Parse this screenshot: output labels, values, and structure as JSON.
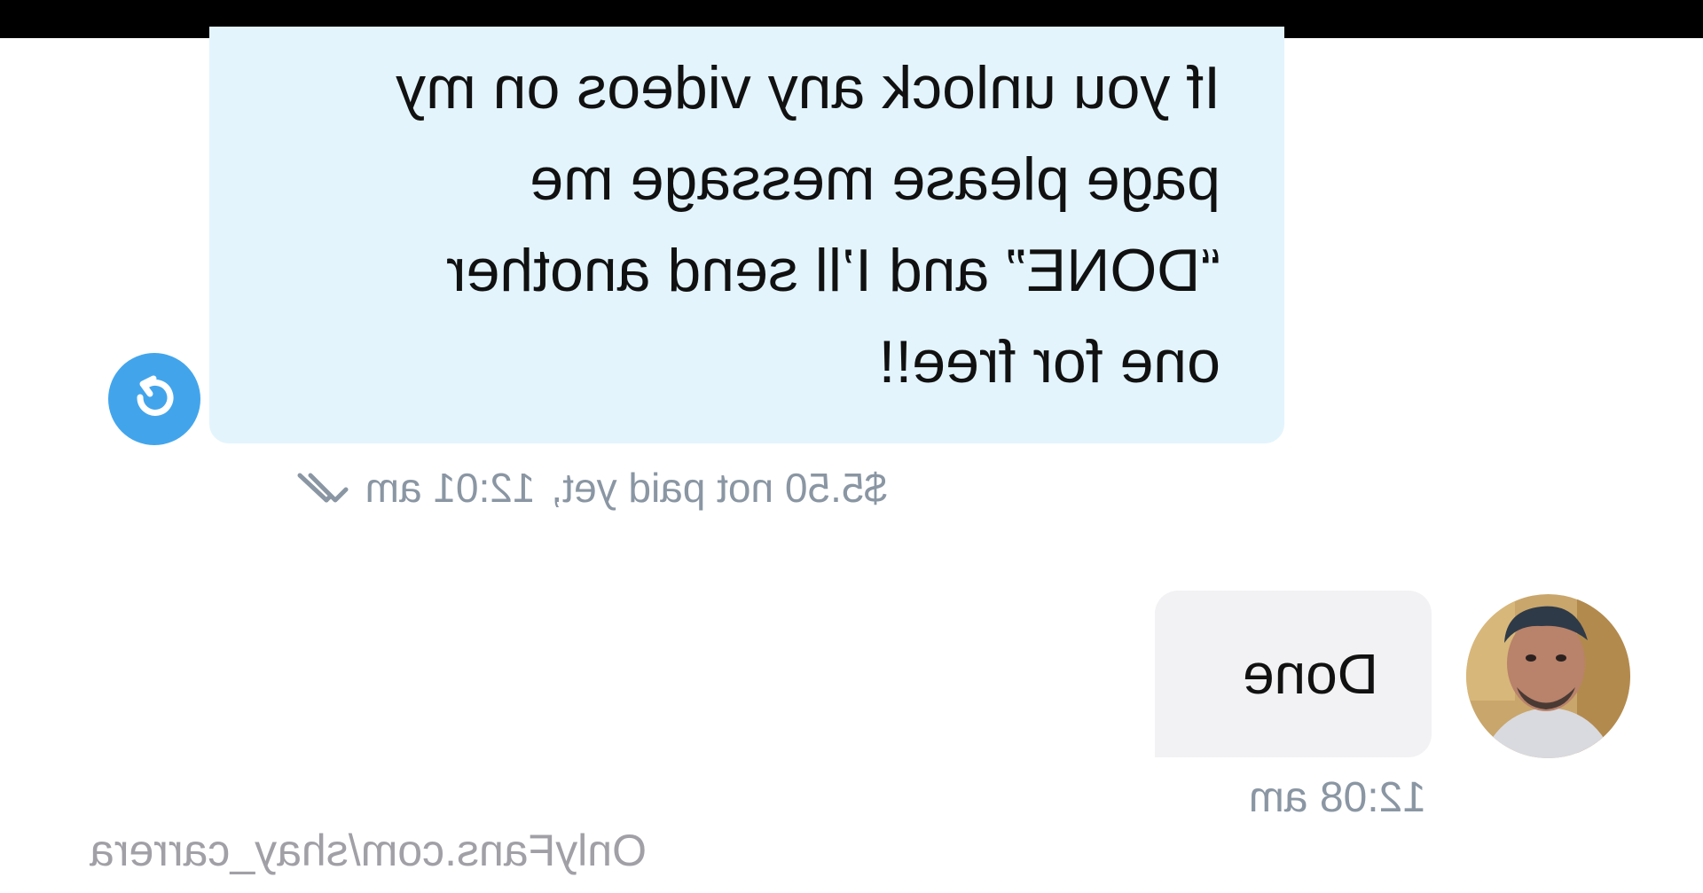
{
  "top_bar": {
    "color": "#000000"
  },
  "messages": [
    {
      "direction": "incoming",
      "text": "If you unlock any videos on my\npage please message me\n“DONE” and I’ll send another\none for free!!",
      "price_label": "$5.50 not paid yet,",
      "time": "12:01 am",
      "bubble_color": "#e3f4fd",
      "badge_icon": "repeat-icon",
      "badge_color": "#42a5ec",
      "status_icon": "double-check-icon"
    },
    {
      "direction": "outgoing",
      "text": "Done",
      "time": "12:08 am",
      "bubble_color": "#f2f2f4",
      "avatar_icon": "user-avatar"
    }
  ],
  "watermark": "OnlyFans.com/shay_carrera",
  "mirrored": true
}
